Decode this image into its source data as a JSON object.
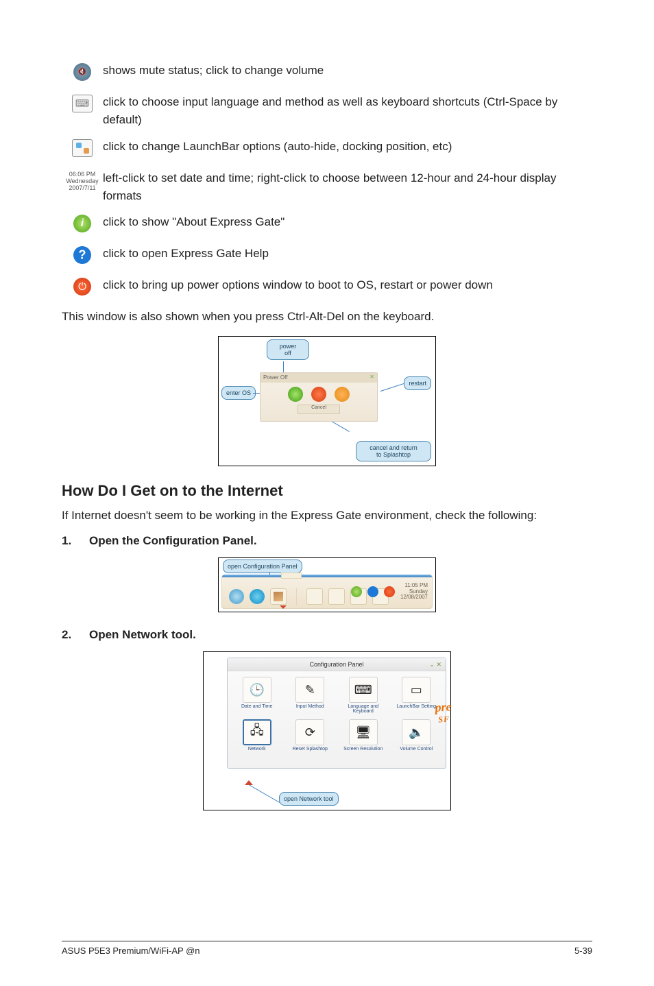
{
  "rows": {
    "mute": "shows mute status; click to change volume",
    "input": "click to choose input language and method as well as keyboard shortcuts (Ctrl-Space by default)",
    "launch": "click to change LaunchBar options (auto-hide, docking position, etc)",
    "date_icon": {
      "l1": "06:06 PM",
      "l2": "Wednesday",
      "l3": "2007/7/11"
    },
    "date": "left-click to set date and time; right-click to choose between 12-hour and 24-hour display formats",
    "about": "click to show \"About Express Gate\"",
    "help": "click to open Express Gate Help",
    "power": "click to bring up power options window to boot to OS, restart or power down"
  },
  "after_rows": "This window is also shown when you press Ctrl-Alt-Del on the keyboard.",
  "fig1": {
    "dialog_title": "Power Off",
    "cancel_btn": "Cancel",
    "callouts": {
      "poweroff": "power\noff",
      "enter_os": "enter OS",
      "restart": "restart",
      "cancel_return": "cancel and return\nto Splashtop"
    }
  },
  "section_title": "How Do I Get on to the Internet",
  "intro_text": "If Internet doesn't seem to be working in the Express Gate environment, check the following:",
  "step1": {
    "num": "1.",
    "text": "Open the Configuration Panel."
  },
  "fig2": {
    "callout": "open Configuration Panel",
    "clock": {
      "time": "11:05 PM",
      "day": "Sunday",
      "date": "12/08/2007"
    }
  },
  "step2": {
    "num": "2.",
    "text": "Open Network tool."
  },
  "fig3": {
    "panel_title": "Configuration Panel",
    "min_x": "⌄ ✕",
    "cells": [
      {
        "icon": "🕒",
        "label": "Date and Time"
      },
      {
        "icon": "✎",
        "label": "Input Method"
      },
      {
        "icon": "⌨",
        "label": "Language and Keyboard"
      },
      {
        "icon": "▭",
        "label": "LaunchBar Setting"
      },
      {
        "icon": "🖧",
        "label": "Network"
      },
      {
        "icon": "⟳",
        "label": "Reset Splashtop"
      },
      {
        "icon": "🖥",
        "label": "Screen Resolution"
      },
      {
        "icon": "🔈",
        "label": "Volume Control"
      }
    ],
    "callout": "open Network tool",
    "logo": {
      "main": "pre",
      "sub": "SF"
    }
  },
  "footer": {
    "left": "ASUS P5E3 Premium/WiFi-AP @n",
    "right": "5-39"
  }
}
